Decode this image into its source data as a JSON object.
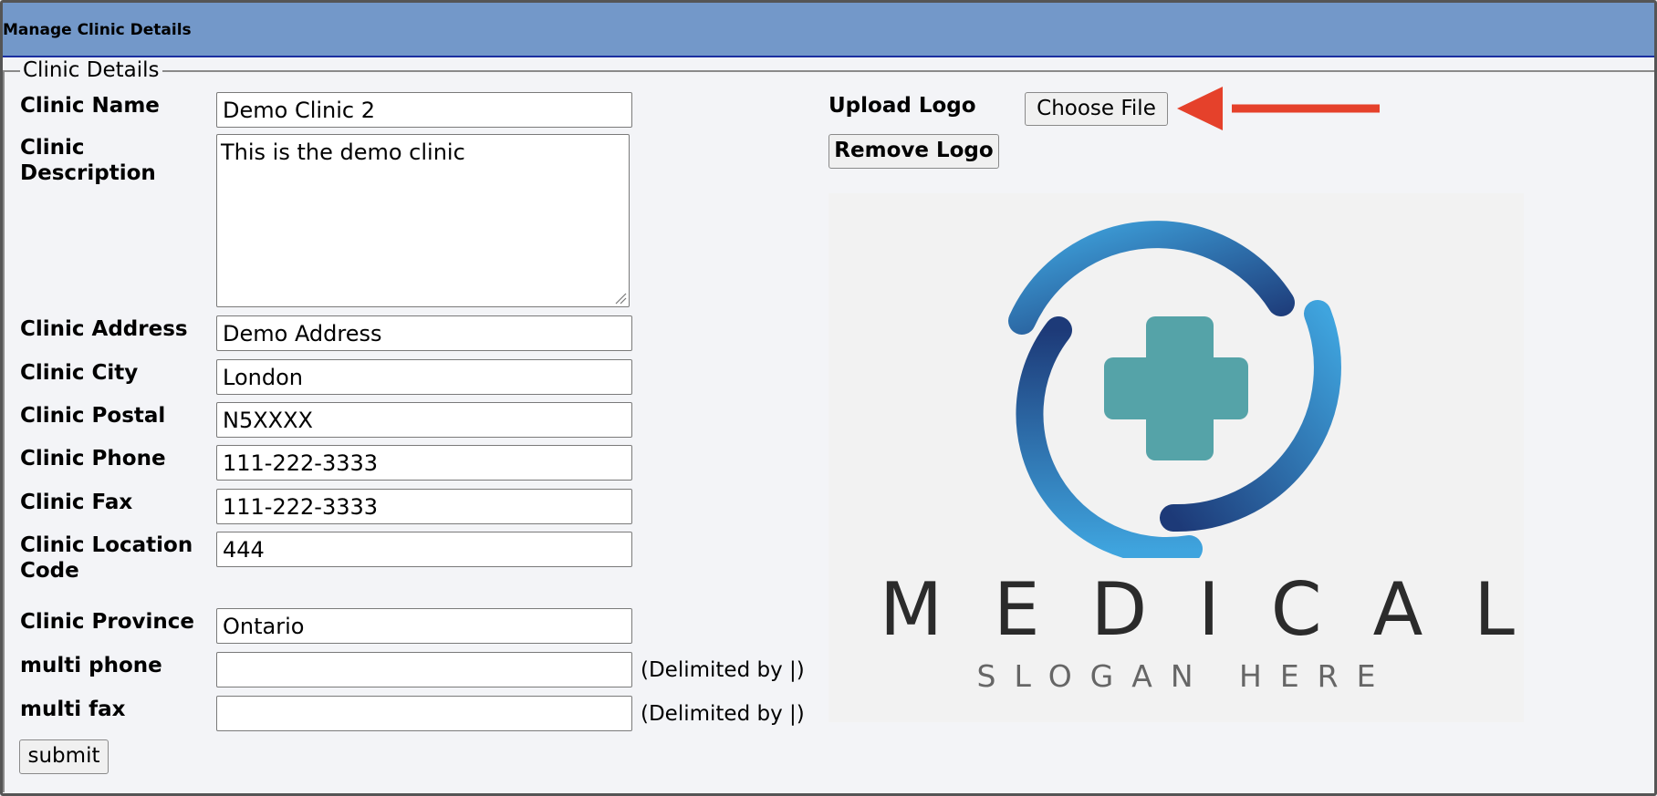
{
  "header": {
    "title": "Manage Clinic Details"
  },
  "form": {
    "legend": "Clinic Details",
    "fields": {
      "clinic_name": {
        "label": "Clinic Name",
        "value": "Demo Clinic 2"
      },
      "clinic_description": {
        "label": "Clinic\nDescription",
        "value": "This is the demo clinic"
      },
      "clinic_address": {
        "label": "Clinic Address",
        "value": "Demo Address"
      },
      "clinic_city": {
        "label": "Clinic City",
        "value": "London"
      },
      "clinic_postal": {
        "label": "Clinic Postal",
        "value": "N5XXXX"
      },
      "clinic_phone": {
        "label": "Clinic Phone",
        "value": "111-222-3333"
      },
      "clinic_fax": {
        "label": "Clinic Fax",
        "value": "111-222-3333"
      },
      "clinic_location_code": {
        "label": "Clinic Location\nCode",
        "value": "444"
      },
      "clinic_province": {
        "label": "Clinic Province",
        "value": "Ontario"
      },
      "multi_phone": {
        "label": "multi phone",
        "value": "",
        "hint": "(Delimited by |)"
      },
      "multi_fax": {
        "label": "multi fax",
        "value": "",
        "hint": "(Delimited by |)"
      }
    },
    "submit_label": "submit"
  },
  "logo": {
    "upload_label": "Upload Logo",
    "choose_file_label": "Choose File",
    "remove_label": "Remove Logo",
    "image_title": "MEDICAL",
    "image_slogan": "SLOGAN HERE"
  },
  "annotation": {
    "arrow_color": "#e5412b"
  },
  "colors": {
    "header_bg": "#7398c9",
    "logo_dark": "#1d3a78",
    "logo_light": "#3fa4de",
    "cross": "#55a3a8"
  }
}
